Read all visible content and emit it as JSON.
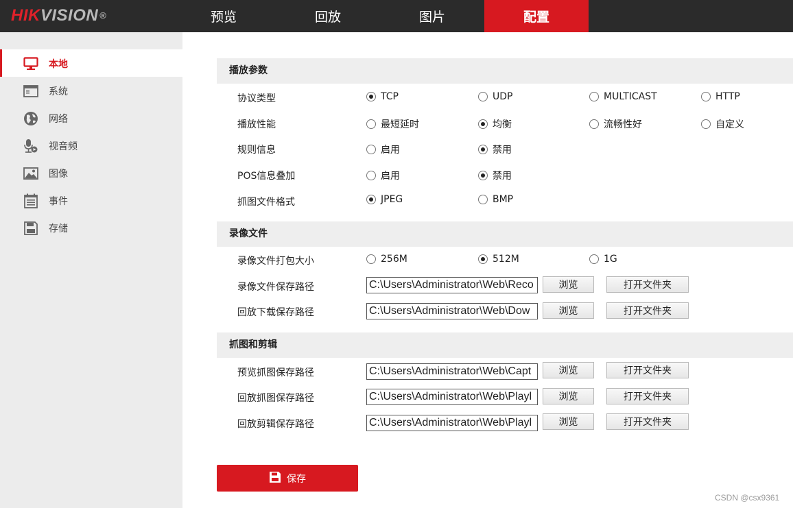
{
  "brand": {
    "logo_red": "HIK",
    "logo_grey": "VISION",
    "logo_reg": "®"
  },
  "nav": {
    "tabs": [
      {
        "label": "预览",
        "active": false
      },
      {
        "label": "回放",
        "active": false
      },
      {
        "label": "图片",
        "active": false
      },
      {
        "label": "配置",
        "active": true
      }
    ]
  },
  "sidebar": {
    "items": [
      {
        "label": "本地",
        "icon": "monitor-icon",
        "active": true
      },
      {
        "label": "系统",
        "icon": "window-icon",
        "active": false
      },
      {
        "label": "网络",
        "icon": "globe-icon",
        "active": false
      },
      {
        "label": "视音频",
        "icon": "microphone-icon",
        "active": false
      },
      {
        "label": "图像",
        "icon": "picture-icon",
        "active": false
      },
      {
        "label": "事件",
        "icon": "calendar-icon",
        "active": false
      },
      {
        "label": "存储",
        "icon": "floppy-disk-icon",
        "active": false
      }
    ]
  },
  "playback": {
    "title": "播放参数",
    "protocol": {
      "label": "协议类型",
      "options": [
        "TCP",
        "UDP",
        "MULTICAST",
        "HTTP"
      ],
      "selected": "TCP"
    },
    "performance": {
      "label": "播放性能",
      "options": [
        "最短延时",
        "均衡",
        "流畅性好",
        "自定义"
      ],
      "selected": "均衡"
    },
    "rule_info": {
      "label": "规则信息",
      "options": [
        "启用",
        "禁用"
      ],
      "selected": "禁用"
    },
    "pos_overlay": {
      "label": "POS信息叠加",
      "options": [
        "启用",
        "禁用"
      ],
      "selected": "禁用"
    },
    "snapshot_format": {
      "label": "抓图文件格式",
      "options": [
        "JPEG",
        "BMP"
      ],
      "selected": "JPEG"
    }
  },
  "record": {
    "title": "录像文件",
    "pack_size": {
      "label": "录像文件打包大小",
      "options": [
        "256M",
        "512M",
        "1G"
      ],
      "selected": "512M"
    },
    "save_path": {
      "label": "录像文件保存路径",
      "value": "C:\\Users\\Administrator\\Web\\Reco"
    },
    "download_path": {
      "label": "回放下载保存路径",
      "value": "C:\\Users\\Administrator\\Web\\Dow"
    }
  },
  "capture": {
    "title": "抓图和剪辑",
    "preview_path": {
      "label": "预览抓图保存路径",
      "value": "C:\\Users\\Administrator\\Web\\Capt"
    },
    "playback_snap_path": {
      "label": "回放抓图保存路径",
      "value": "C:\\Users\\Administrator\\Web\\Playl"
    },
    "playback_clip_path": {
      "label": "回放剪辑保存路径",
      "value": "C:\\Users\\Administrator\\Web\\Playl"
    }
  },
  "buttons": {
    "browse": "浏览",
    "open_folder": "打开文件夹",
    "save": "保存"
  },
  "watermark": "CSDN @csx9361",
  "colors": {
    "accent": "#d71920",
    "header_bg": "#2b2b2b",
    "sidebar_bg": "#ececec",
    "section_bg": "#eeeeee"
  }
}
